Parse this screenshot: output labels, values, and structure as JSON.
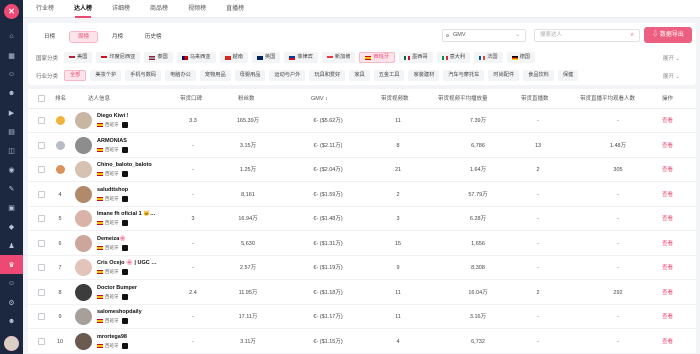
{
  "top_tabs": [
    "行业榜",
    "达人榜",
    "详细榜",
    "商品榜",
    "视频榜",
    "直播榜"
  ],
  "period_tabs": [
    "日榜",
    "周榜",
    "月榜",
    "历史榜"
  ],
  "gmv_select": "GMV",
  "search_placeholder": "搜索达人",
  "export_label": "数据导出",
  "country_label": "国家分类",
  "countries": [
    "美国",
    "印度尼西亚",
    "泰国",
    "马来西亚",
    "越南",
    "英国",
    "菲律宾",
    "新加坡",
    "西班牙",
    "墨西哥",
    "意大利",
    "法国",
    "德国"
  ],
  "category_label": "行业分类",
  "categories": [
    "全部",
    "美妆个护",
    "手机与数码",
    "电脑办公",
    "宠物用品",
    "母婴用品",
    "运动与户外",
    "玩具和爱好",
    "家具",
    "五金工具",
    "家装建材",
    "汽车与摩托车",
    "时尚配件",
    "食品饮料",
    "保健"
  ],
  "more_label": "展开",
  "colors": {
    "accent": "#ec4a74",
    "sidebar": "#1c2740"
  },
  "table": {
    "headers": [
      "排名",
      "达人信息",
      "带货口碑",
      "粉丝数",
      "GMV",
      "带货视频数",
      "带货视频平均播放量",
      "带货直播数",
      "带货直播平均观看人数",
      "操作"
    ],
    "gmv_icon": "sort-icon",
    "rows": [
      {
        "rank": "1",
        "name": "Diego Kiwi !",
        "country": "西班牙",
        "score": "3.3",
        "fans": "165.39万",
        "gmv": "€- ($5.62万)",
        "videos": "11",
        "video_avg": "7.39万",
        "lives": "-",
        "live_avg": "-",
        "action": "查看"
      },
      {
        "rank": "2",
        "name": "ARMONIAS",
        "country": "西班牙",
        "score": "-",
        "fans": "3.15万",
        "gmv": "€- ($2.11万)",
        "videos": "8",
        "video_avg": "6,786",
        "lives": "13",
        "live_avg": "1.48万",
        "action": "查看"
      },
      {
        "rank": "3",
        "name": "Chino_baloto_baloto",
        "country": "西班牙",
        "score": "-",
        "fans": "1.25万",
        "gmv": "€- ($2.04万)",
        "videos": "21",
        "video_avg": "1.64万",
        "lives": "2",
        "live_avg": "305",
        "action": "查看"
      },
      {
        "rank": "4",
        "name": "saludttshop",
        "country": "西班牙",
        "score": "-",
        "fans": "8,161",
        "gmv": "€- ($1.59万)",
        "videos": "2",
        "video_avg": "57.79万",
        "lives": "-",
        "live_avg": "-",
        "action": "查看"
      },
      {
        "rank": "5",
        "name": "Imane fh oficial 1 🐱…",
        "country": "西班牙",
        "score": "3",
        "fans": "16.94万",
        "gmv": "€- ($1.48万)",
        "videos": "3",
        "video_avg": "6.28万",
        "lives": "-",
        "live_avg": "-",
        "action": "查看"
      },
      {
        "rank": "6",
        "name": "Demeiza🌸",
        "country": "西班牙",
        "score": "-",
        "fans": "5,630",
        "gmv": "€- ($1.31万)",
        "videos": "15",
        "video_avg": "1,656",
        "lives": "-",
        "live_avg": "-",
        "action": "查看"
      },
      {
        "rank": "7",
        "name": "Cris Ocejo 🌸 | UGC …",
        "country": "西班牙",
        "score": "-",
        "fans": "2.57万",
        "gmv": "€- ($1.19万)",
        "videos": "9",
        "video_avg": "8,308",
        "lives": "-",
        "live_avg": "-",
        "action": "查看"
      },
      {
        "rank": "8",
        "name": "Doctor Bumper",
        "country": "西班牙",
        "score": "2.4",
        "fans": "11.95万",
        "gmv": "€- ($1.18万)",
        "videos": "11",
        "video_avg": "16.04万",
        "lives": "2",
        "live_avg": "292",
        "action": "查看"
      },
      {
        "rank": "9",
        "name": "salomeshopdaily",
        "country": "西班牙",
        "score": "-",
        "fans": "17.11万",
        "gmv": "€- ($1.17万)",
        "videos": "11",
        "video_avg": "3.16万",
        "lives": "-",
        "live_avg": "-",
        "action": "查看"
      },
      {
        "rank": "10",
        "name": "mrortega98",
        "country": "西班牙",
        "score": "-",
        "fans": "3.11万",
        "gmv": "€- ($1.15万)",
        "videos": "4",
        "video_avg": "6,732",
        "lives": "-",
        "live_avg": "-",
        "action": "查看"
      }
    ]
  }
}
